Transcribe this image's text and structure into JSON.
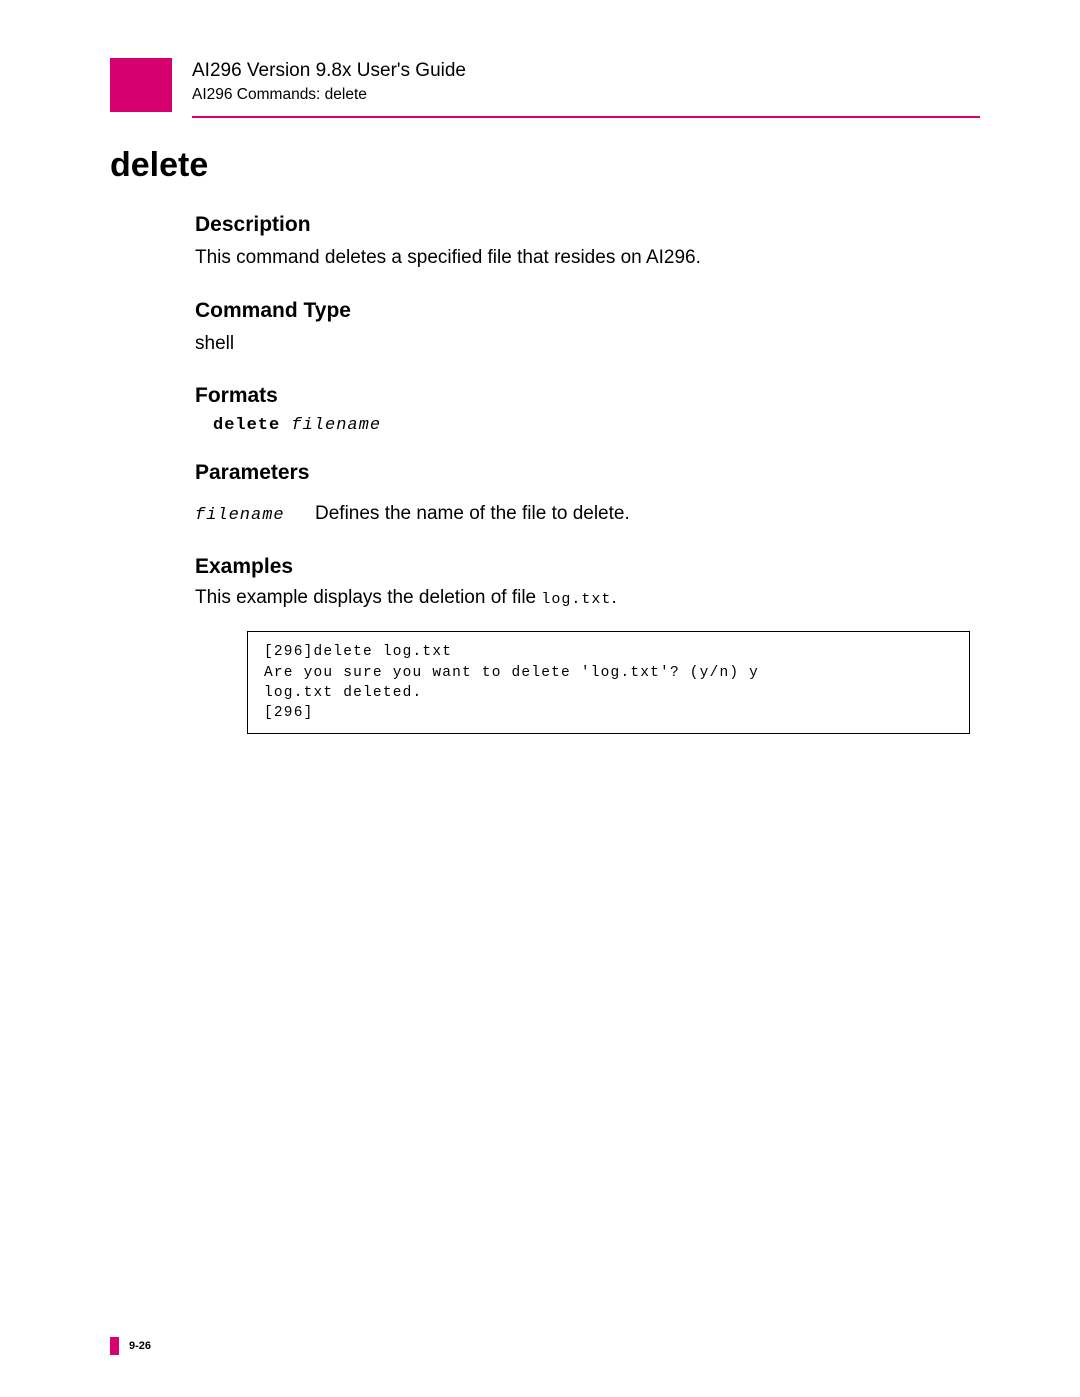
{
  "header": {
    "guide_title": "AI296 Version 9.8x User's Guide",
    "breadcrumb": "AI296 Commands: delete"
  },
  "page_title": "delete",
  "sections": {
    "description": {
      "heading": "Description",
      "text": "This command deletes a specified file that resides on AI296."
    },
    "command_type": {
      "heading": "Command Type",
      "text": "shell"
    },
    "formats": {
      "heading": "Formats",
      "cmd": "delete ",
      "param": "filename"
    },
    "parameters": {
      "heading": "Parameters",
      "rows": [
        {
          "name": "filename",
          "desc": "Defines the name of the file to delete."
        }
      ]
    },
    "examples": {
      "heading": "Examples",
      "intro_prefix": "This example displays the deletion of file ",
      "intro_code": "log.txt",
      "intro_suffix": ".",
      "code": "[296]delete log.txt\nAre you sure you want to delete 'log.txt'? (y/n) y\nlog.txt deleted.\n[296]"
    }
  },
  "footer": {
    "page_number": "9-26"
  }
}
